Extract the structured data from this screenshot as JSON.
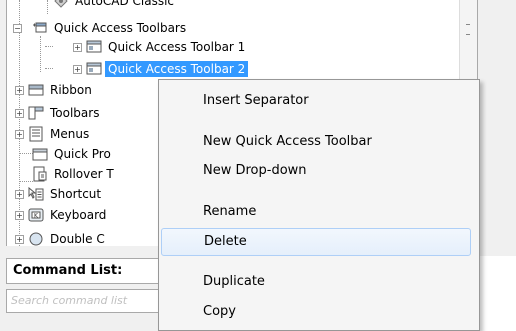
{
  "tree": {
    "items": [
      {
        "label": "AutoCAD Classic",
        "icon": "workspace-icon"
      },
      {
        "label": "Quick Access Toolbars",
        "icon": "toolbar-folder-icon"
      },
      {
        "label": "Quick Access Toolbar 1",
        "icon": "toolbar-icon"
      },
      {
        "label": "Quick Access Toolbar 2",
        "icon": "toolbar-icon",
        "selected": true
      },
      {
        "label": "Ribbon",
        "icon": "ribbon-icon"
      },
      {
        "label": "Toolbars",
        "icon": "toolbars-icon"
      },
      {
        "label": "Menus",
        "icon": "menus-icon"
      },
      {
        "label": "Quick Pro",
        "icon": "quick-properties-icon"
      },
      {
        "label": "Rollover T",
        "icon": "rollover-tooltip-icon"
      },
      {
        "label": "Shortcut",
        "icon": "shortcut-menu-icon"
      },
      {
        "label": "Keyboard",
        "icon": "keyboard-icon"
      },
      {
        "label": "Double C",
        "icon": "double-click-icon"
      }
    ],
    "selected_color": "#3399ff"
  },
  "command_list": {
    "header": "Command List:",
    "search_placeholder": "Search command list"
  },
  "context_menu": {
    "items": [
      {
        "label": "Insert Separator"
      },
      {
        "label": "New Quick Access Toolbar"
      },
      {
        "label": "New Drop-down"
      },
      {
        "label": "Rename"
      },
      {
        "label": "Delete",
        "hovered": true
      },
      {
        "label": "Duplicate"
      },
      {
        "label": "Copy"
      }
    ],
    "hover_border_color": "#aecff7"
  }
}
